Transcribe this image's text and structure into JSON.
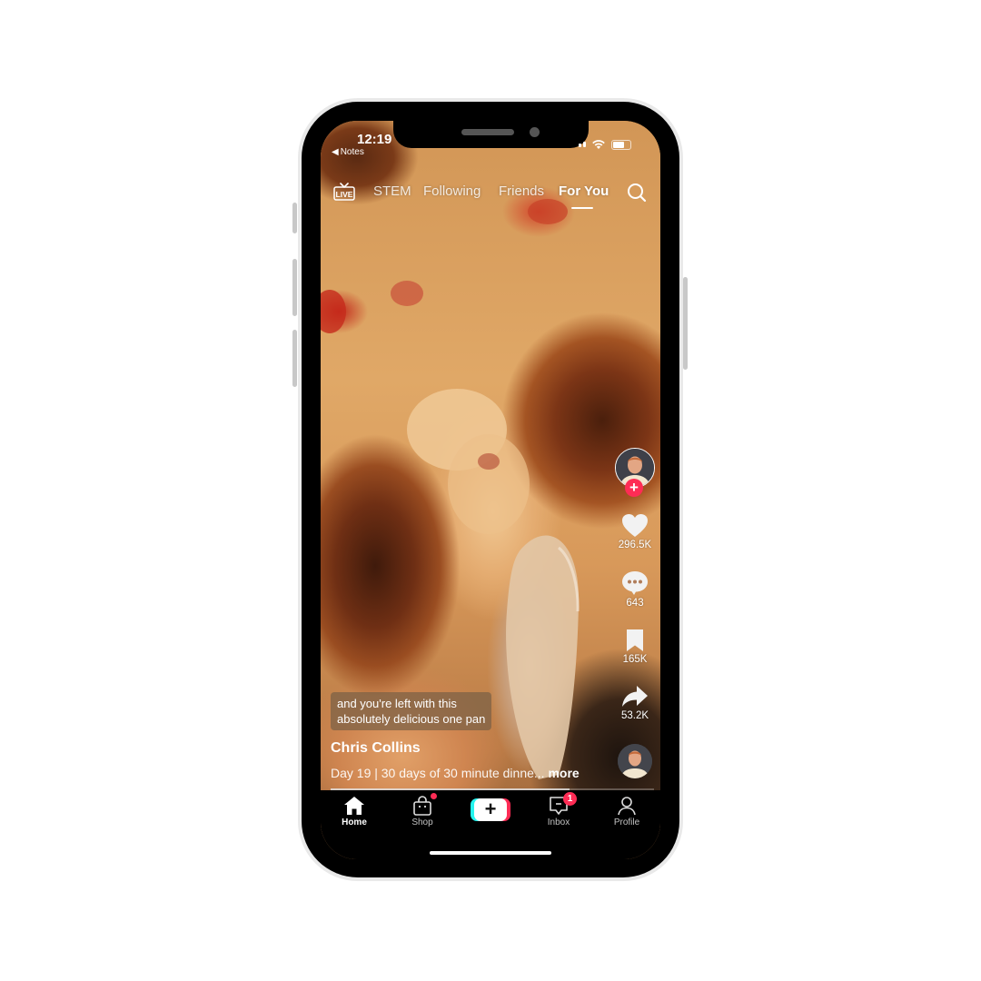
{
  "status_bar": {
    "time": "12:19",
    "back_app": "Notes"
  },
  "top_nav": {
    "live_label": "LIVE",
    "tabs": [
      {
        "label": "STEM",
        "active": false
      },
      {
        "label": "Following",
        "active": false
      },
      {
        "label": "Friends",
        "active": false
      },
      {
        "label": "For You",
        "active": true
      }
    ]
  },
  "video": {
    "caption_line1": "and you're left with this",
    "caption_line2": "absolutely delicious one pan",
    "author": "Chris Collins",
    "description": "Day 19 | 30 days of 30 minute dinne...",
    "more_label": "more",
    "progress_percent": 74
  },
  "actions": {
    "likes": "296.5K",
    "comments": "643",
    "saves": "165K",
    "shares": "53.2K"
  },
  "bottom_nav": {
    "items": [
      {
        "label": "Home",
        "active": true
      },
      {
        "label": "Shop",
        "active": false,
        "has_dot": true
      },
      {
        "label": "",
        "type": "create"
      },
      {
        "label": "Inbox",
        "active": false,
        "badge": "1"
      },
      {
        "label": "Profile",
        "active": false
      }
    ]
  },
  "colors": {
    "accent": "#fe2c55",
    "cyan": "#25f4ee",
    "nav_bg": "#000000"
  }
}
